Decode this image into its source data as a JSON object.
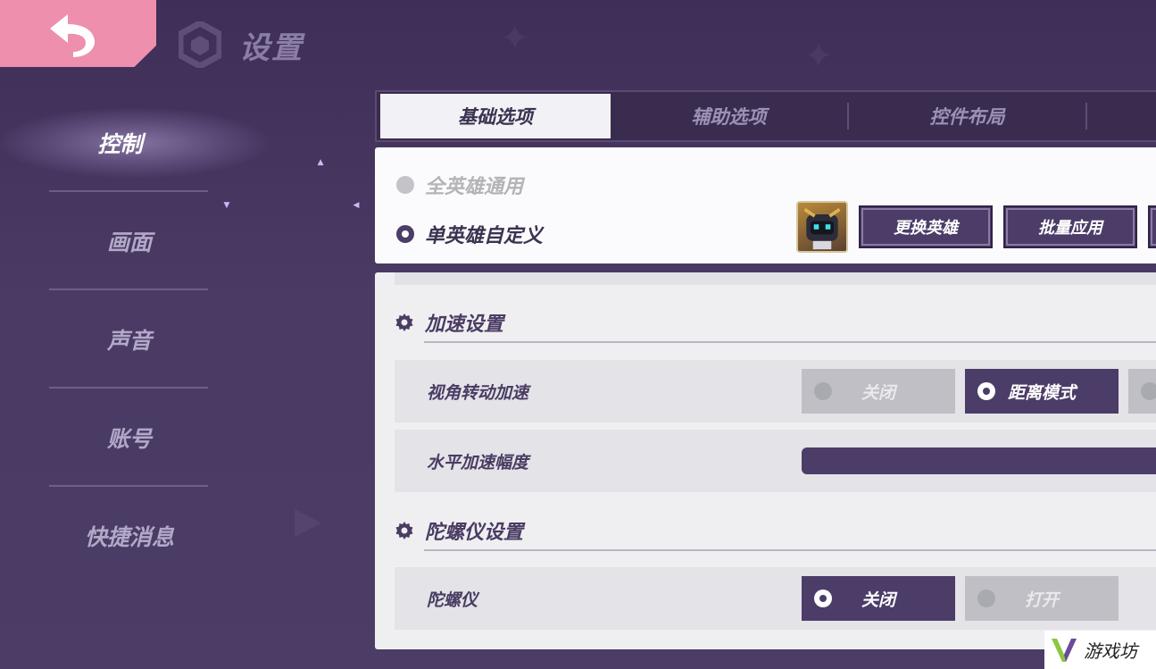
{
  "header": {
    "title": "设置"
  },
  "sidebar": {
    "items": [
      {
        "label": "控制"
      },
      {
        "label": "画面"
      },
      {
        "label": "声音"
      },
      {
        "label": "账号"
      },
      {
        "label": "快捷消息"
      }
    ]
  },
  "tabs": [
    {
      "label": "基础选项"
    },
    {
      "label": "辅助选项"
    },
    {
      "label": "控件布局"
    }
  ],
  "hero_mode": {
    "option_all": "全英雄通用",
    "option_single": "单英雄自定义",
    "change_hero_label": "更换英雄",
    "batch_apply_label": "批量应用"
  },
  "sections": {
    "acceleration": {
      "title": "加速设置",
      "view_rotation": {
        "label": "视角转动加速",
        "opt_off": "关闭",
        "opt_distance": "距离模式"
      },
      "horizontal": {
        "label": "水平加速幅度"
      }
    },
    "gyroscope": {
      "title": "陀螺仪设置",
      "gyro": {
        "label": "陀螺仪",
        "opt_off": "关闭",
        "opt_on": "打开"
      }
    }
  },
  "watermark": {
    "text": "游戏坊"
  },
  "colors": {
    "accent": "#4c3c68",
    "back_button": "#ee8fae",
    "background": "#4a3a64"
  }
}
